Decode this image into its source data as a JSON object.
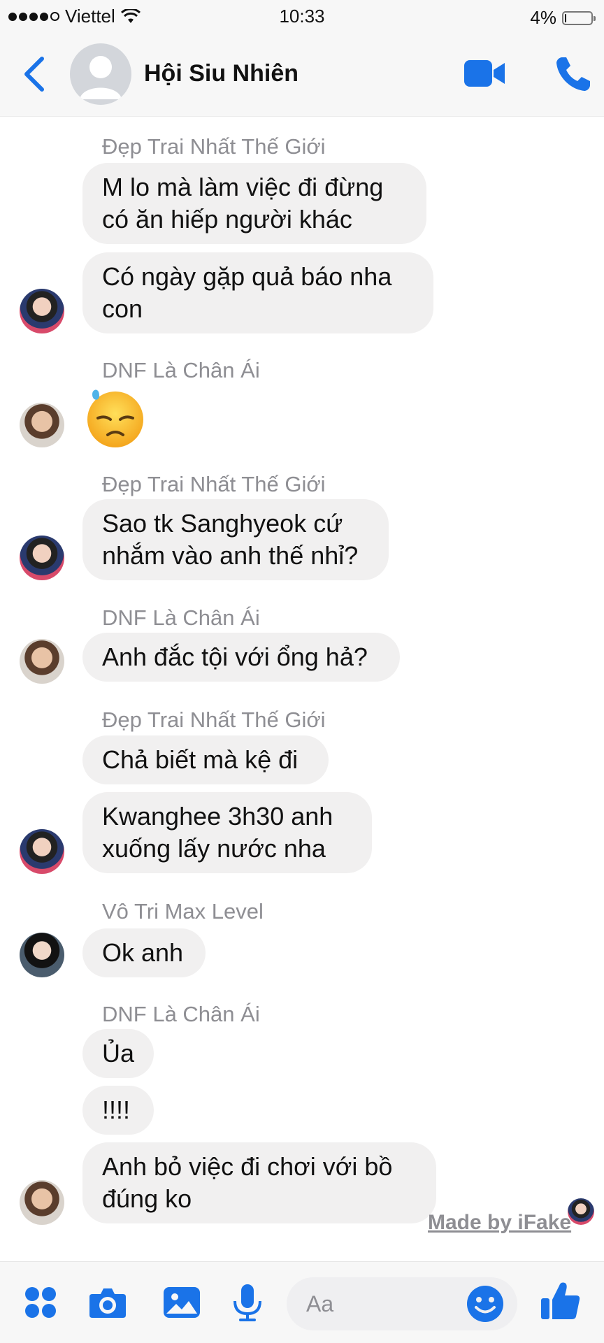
{
  "status_bar": {
    "carrier": "Viettel",
    "time": "10:33",
    "battery": "4%",
    "battery_level": 0.04
  },
  "header": {
    "title": "Hội Siu Nhiên"
  },
  "messages": [
    {
      "sender": "Đẹp Trai Nhất Thế Giới",
      "bubbles": [
        "M lo mà làm việc đi đừng có ăn hiếp người khác",
        "Có ngày gặp quả báo nha con"
      ]
    },
    {
      "sender": "DNF Là Chân Ái",
      "emoji": "downcast-face-with-sweat"
    },
    {
      "sender": "Đẹp Trai Nhất Thế Giới",
      "bubbles": [
        "Sao tk Sanghyeok cứ nhắm vào anh thế nhỉ?"
      ]
    },
    {
      "sender": "DNF Là Chân Ái",
      "bubbles": [
        "Anh đắc tội với ổng hả?"
      ]
    },
    {
      "sender": "Đẹp Trai Nhất Thế Giới",
      "bubbles": [
        "Chả biết mà kệ đi",
        "Kwanghee 3h30 anh xuống lấy nước nha"
      ]
    },
    {
      "sender": "Vô Tri Max Level",
      "bubbles": [
        "Ok anh"
      ]
    },
    {
      "sender": "DNF Là Chân Ái",
      "bubbles": [
        "Ủa",
        "!!!!",
        "Anh bỏ việc đi chơi với bồ đúng ko"
      ]
    }
  ],
  "watermark": "Made by iFake",
  "composer": {
    "placeholder": "Aa"
  },
  "colors": {
    "accent": "#1a73e8",
    "bubble": "#f1f0f0",
    "sender_text": "#8e8e93"
  }
}
